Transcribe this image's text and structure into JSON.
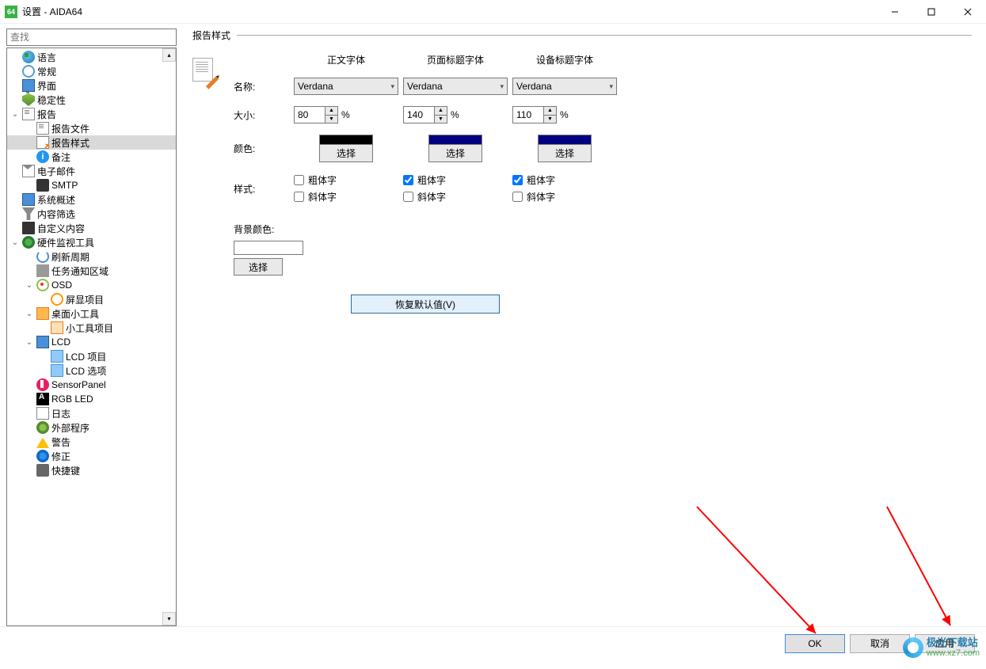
{
  "window": {
    "app_icon_text": "64",
    "title": "设置 - AIDA64"
  },
  "sidebar": {
    "search_placeholder": "查找"
  },
  "tree": [
    {
      "label": "语言",
      "icon": "ic-globe",
      "indent": 0
    },
    {
      "label": "常规",
      "icon": "ic-gear",
      "indent": 0
    },
    {
      "label": "界面",
      "icon": "ic-monitor",
      "indent": 0
    },
    {
      "label": "稳定性",
      "icon": "ic-shield",
      "indent": 0
    },
    {
      "label": "报告",
      "icon": "ic-report",
      "indent": 0,
      "expander": "v"
    },
    {
      "label": "报告文件",
      "icon": "ic-report",
      "indent": 1
    },
    {
      "label": "报告样式",
      "icon": "ic-report-style",
      "indent": 1,
      "selected": true
    },
    {
      "label": "备注",
      "icon": "ic-info",
      "indent": 1,
      "info": "i"
    },
    {
      "label": "电子邮件",
      "icon": "ic-mail",
      "indent": 0
    },
    {
      "label": "SMTP",
      "icon": "ic-smtp",
      "indent": 1
    },
    {
      "label": "系统概述",
      "icon": "ic-sys",
      "indent": 0
    },
    {
      "label": "内容筛选",
      "icon": "ic-filter",
      "indent": 0
    },
    {
      "label": "自定义内容",
      "icon": "ic-custom",
      "indent": 0
    },
    {
      "label": "硬件监视工具",
      "icon": "ic-hw",
      "indent": 0,
      "expander": "v"
    },
    {
      "label": "刷新周期",
      "icon": "ic-refresh",
      "indent": 1
    },
    {
      "label": "任务通知区域",
      "icon": "ic-tray",
      "indent": 1
    },
    {
      "label": "OSD",
      "icon": "ic-osd",
      "indent": 1,
      "expander": "v"
    },
    {
      "label": "屏显项目",
      "icon": "ic-screen-item",
      "indent": 2
    },
    {
      "label": "桌面小工具",
      "icon": "ic-gadget",
      "indent": 1,
      "expander": "v"
    },
    {
      "label": "小工具项目",
      "icon": "ic-gadget-item",
      "indent": 2
    },
    {
      "label": "LCD",
      "icon": "ic-lcd",
      "indent": 1,
      "expander": "v"
    },
    {
      "label": "LCD 项目",
      "icon": "ic-lcd-item",
      "indent": 2
    },
    {
      "label": "LCD 选项",
      "icon": "ic-lcd-item",
      "indent": 2
    },
    {
      "label": "SensorPanel",
      "icon": "ic-sensor",
      "indent": 1
    },
    {
      "label": "RGB LED",
      "icon": "ic-rgb",
      "indent": 1
    },
    {
      "label": "日志",
      "icon": "ic-log",
      "indent": 1
    },
    {
      "label": "外部程序",
      "icon": "ic-ext",
      "indent": 1
    },
    {
      "label": "警告",
      "icon": "ic-warn",
      "indent": 1
    },
    {
      "label": "修正",
      "icon": "ic-fix",
      "indent": 1
    },
    {
      "label": "快捷键",
      "icon": "ic-key",
      "indent": 1
    }
  ],
  "content": {
    "section_title": "报告样式",
    "columns": [
      "正文字体",
      "页面标题字体",
      "设备标题字体"
    ],
    "rows": {
      "name_label": "名称:",
      "size_label": "大小:",
      "color_label": "颜色:",
      "style_label": "样式:"
    },
    "fonts": [
      {
        "name": "Verdana",
        "size": "80",
        "color": "#000000",
        "bold": false,
        "italic": false
      },
      {
        "name": "Verdana",
        "size": "140",
        "color": "#000080",
        "bold": true,
        "italic": false
      },
      {
        "name": "Verdana",
        "size": "110",
        "color": "#000080",
        "bold": true,
        "italic": false
      }
    ],
    "percent_symbol": "%",
    "choose_label": "选择",
    "bold_label": "粗体字",
    "italic_label": "斜体字",
    "bg_label": "背景颜色:",
    "bg_choose": "选择",
    "restore_label": "恢复默认值(V)"
  },
  "footer": {
    "ok": "OK",
    "cancel": "取消",
    "apply": "应用"
  },
  "watermark": {
    "line1": "极光下载站",
    "line2": "www.xz7.com"
  }
}
